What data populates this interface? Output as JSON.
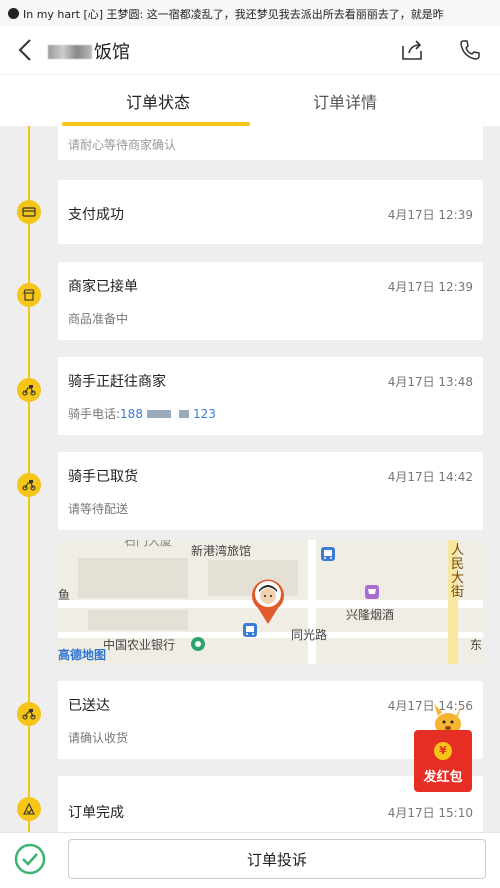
{
  "notification": {
    "text": "In my hart [心] 王梦圆: 这一宿都凌乱了，我还梦见我去派出所去看丽丽去了，就是昨"
  },
  "header": {
    "title_suffix": "饭馆"
  },
  "tabs": [
    {
      "label": "订单状态"
    },
    {
      "label": "订单详情"
    }
  ],
  "timeline": {
    "top_partial": "请耐心等待商家确认",
    "items": [
      {
        "label": "支付成功",
        "time": "4月17日 12:39",
        "sub": "",
        "icon": "card-icon"
      },
      {
        "label": "商家已接单",
        "time": "4月17日 12:39",
        "sub": "商品准备中",
        "icon": "shop-icon"
      },
      {
        "label": "骑手正赶往商家",
        "time": "4月17日 13:48",
        "sub_prefix": "骑手电话:",
        "phone_start": "188",
        "phone_end": "123",
        "icon": "scooter-icon"
      },
      {
        "label": "骑手已取货",
        "time": "4月17日 14:42",
        "sub": "请等待配送",
        "icon": "scooter-icon"
      },
      {
        "label": "已送达",
        "time": "4月17日 14:56",
        "sub": "请确认收货",
        "icon": "scooter-icon"
      },
      {
        "label": "订单完成",
        "time": "4月17日 15:10",
        "sub": "",
        "icon": "complete-icon"
      }
    ]
  },
  "map": {
    "labels": {
      "hotel": "新港湾旅馆",
      "shop": "兴隆烟酒",
      "bank": "中国农业银行",
      "road": "同光路",
      "street": "人民大街",
      "fish": "鱼",
      "brand": "高德地图",
      "top": "石门大厦",
      "edge": "东"
    }
  },
  "red_packet": {
    "label": "发红包",
    "coin": "¥"
  },
  "bottom": {
    "complaint_label": "订单投诉"
  },
  "colors": {
    "accent": "#f5c518",
    "link": "#3a7bd5",
    "red": "#e62e24"
  }
}
